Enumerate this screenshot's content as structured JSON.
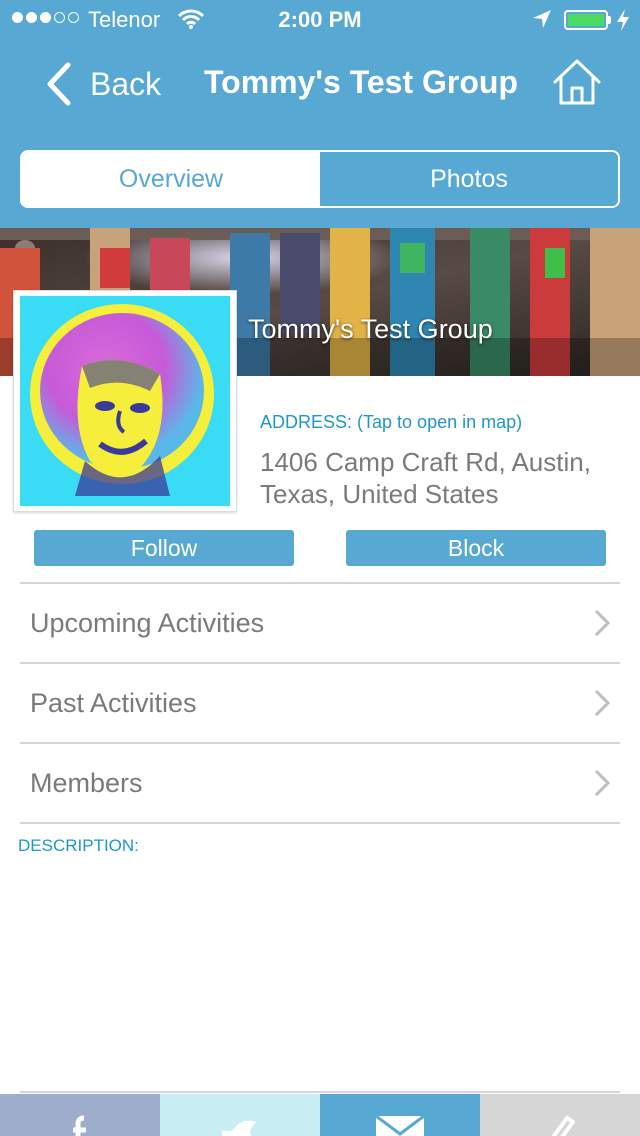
{
  "status_bar": {
    "carrier": "Telenor",
    "time": "2:00 PM",
    "signal_bars_filled": 3,
    "signal_bars_total": 5,
    "battery_level": 1.0
  },
  "navbar": {
    "back_label": "Back",
    "title": "Tommy's Test Group",
    "home_icon": "home-icon"
  },
  "tabs": [
    {
      "label": "Overview",
      "selected": true
    },
    {
      "label": "Photos",
      "selected": false
    }
  ],
  "group": {
    "name": "Tommy's Test Group",
    "address_label": "ADDRESS: (Tap to open in map)",
    "address": "1406 Camp Craft Rd, Austin, Texas, United States"
  },
  "actions": {
    "follow_label": "Follow",
    "block_label": "Block"
  },
  "menu": [
    {
      "label": "Upcoming Activities"
    },
    {
      "label": "Past Activities"
    },
    {
      "label": "Members"
    }
  ],
  "description": {
    "label": "DESCRIPTION:",
    "text": ""
  },
  "share_bar": [
    {
      "icon": "facebook-icon",
      "color": "#9eadcb"
    },
    {
      "icon": "twitter-icon",
      "color": "#c8eef3"
    },
    {
      "icon": "mail-icon",
      "color": "#57a8d2"
    },
    {
      "icon": "pencil-icon",
      "color": "#d6d6d6"
    }
  ],
  "colors": {
    "header": "#57a8d2",
    "accent_text": "#1f97c9",
    "body_text": "#7a7a7a",
    "battery": "#4cd964"
  }
}
